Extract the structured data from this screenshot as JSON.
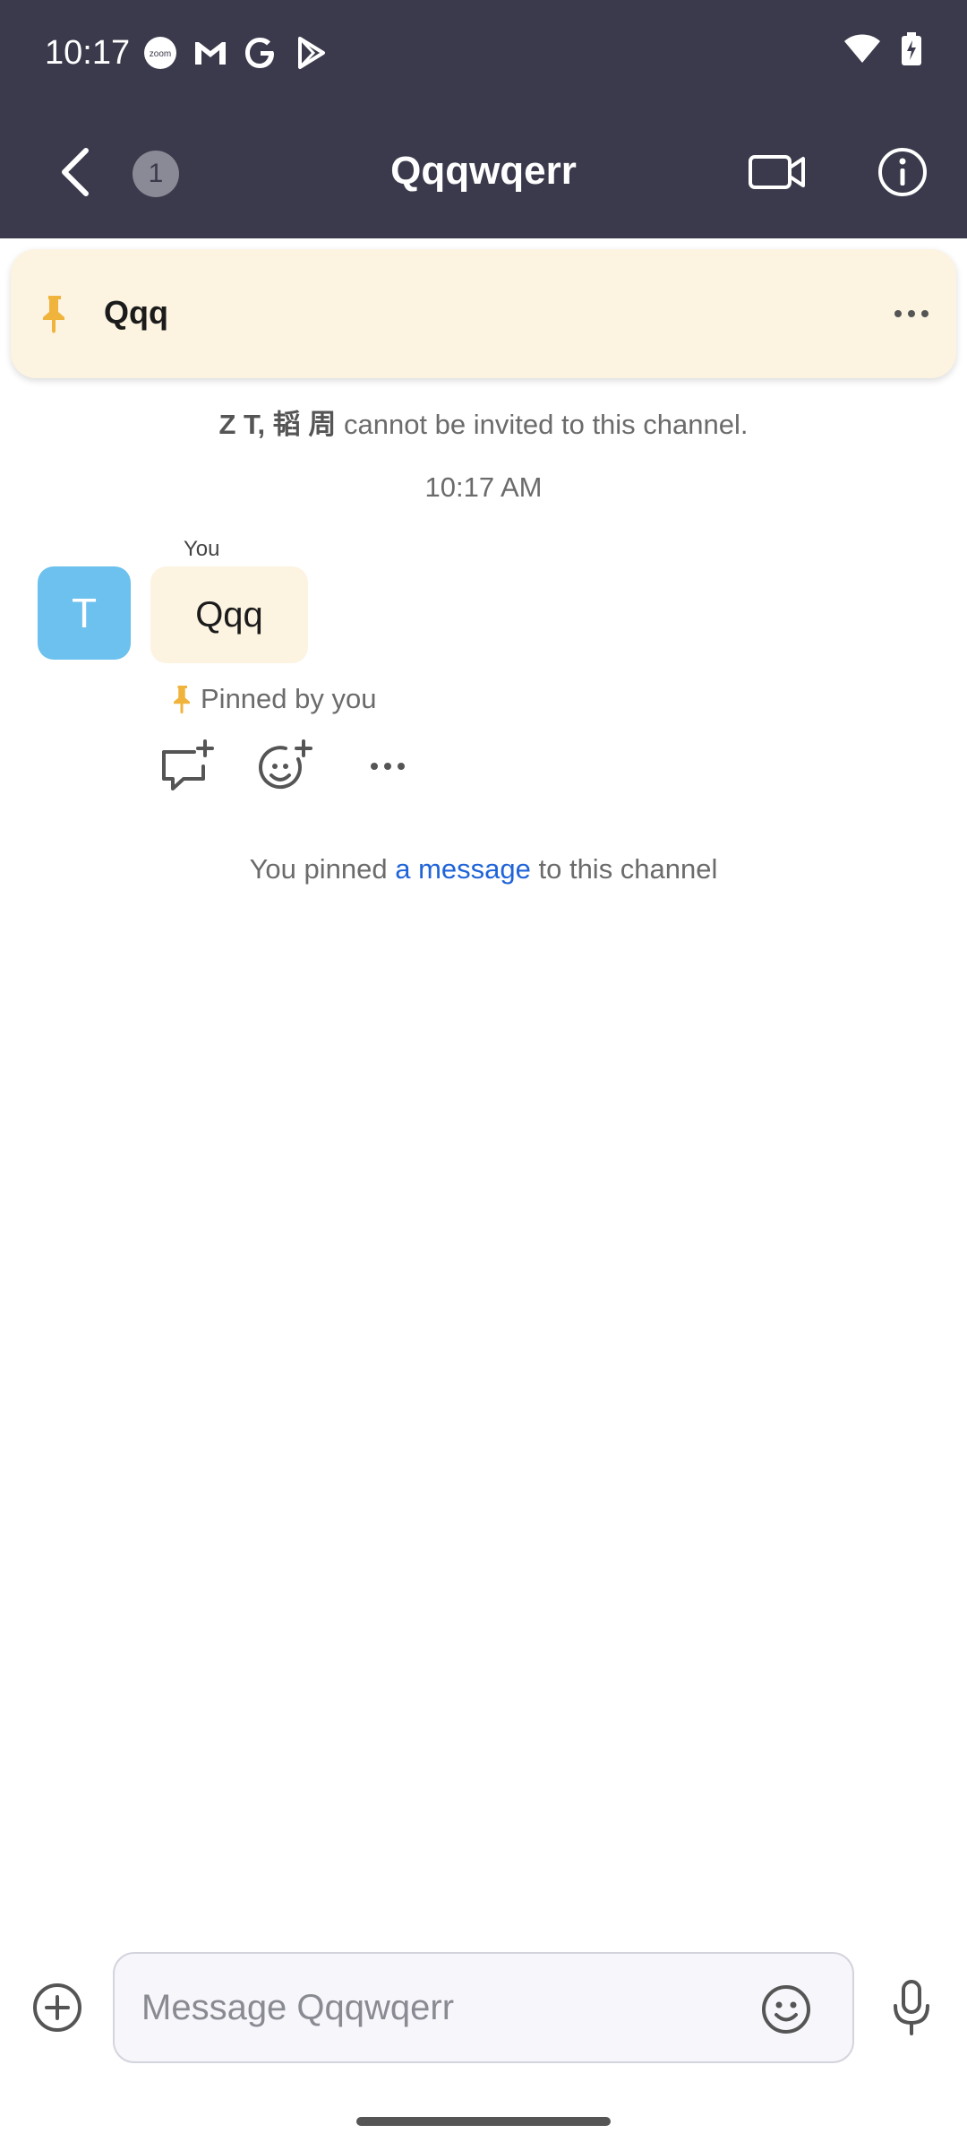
{
  "status_bar": {
    "time": "10:17",
    "notification_icons": [
      "zoom-icon",
      "gmail-icon",
      "google-icon",
      "play-store-icon"
    ],
    "system_icons": [
      "wifi-icon",
      "battery-charging-icon"
    ]
  },
  "header": {
    "unread_count": "1",
    "title": "Qqqwqerr",
    "background": "#3a3a4c"
  },
  "pinned_banner": {
    "text": "Qqq",
    "background": "#fcf3e1",
    "pin_color": "#f0b43c"
  },
  "system_notice": {
    "names": "Z T, 韬 周",
    "text": " cannot be invited to this channel."
  },
  "timestamp": "10:17 AM",
  "message": {
    "avatar_initial": "T",
    "avatar_color": "#6cc1ee",
    "sender": "You",
    "text": "Qqq",
    "pinned_label": "Pinned by you"
  },
  "pin_event": {
    "prefix": "You pinned ",
    "link": "a message",
    "suffix": " to this channel",
    "link_color": "#1f64d8"
  },
  "composer": {
    "placeholder": "Message Qqqwqerr"
  }
}
